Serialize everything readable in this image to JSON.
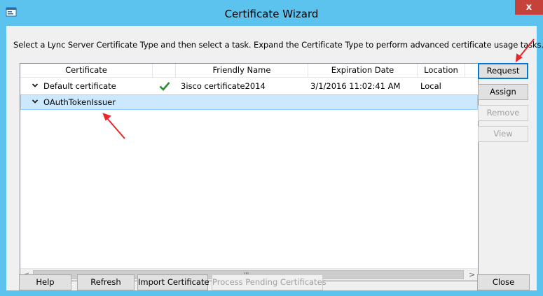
{
  "window": {
    "title": "Certificate Wizard",
    "close_glyph": "x",
    "app_icon": "window-app-icon",
    "accent_color": "#5bc3ee"
  },
  "instructions": "Select a Lync Server Certificate Type and then select a task. Expand the Certificate Type to perform advanced certificate usage tasks.",
  "table": {
    "columns": [
      "Certificate",
      "",
      "Friendly Name",
      "Expiration Date",
      "Location"
    ],
    "rows": [
      {
        "certificate": "Default certificate",
        "status_icon": "check-icon",
        "friendly_name": "3isco certificate2014",
        "expiration_date": "3/1/2016 11:02:41 AM",
        "location": "Local",
        "selected": false
      },
      {
        "certificate": "OAuthTokenIssuer",
        "status_icon": "",
        "friendly_name": "",
        "expiration_date": "",
        "location": "",
        "selected": true
      }
    ],
    "scroll_grip": "III",
    "scroll_left": "<",
    "scroll_right": ">"
  },
  "side_buttons": {
    "request": "Request",
    "assign": "Assign",
    "remove": "Remove",
    "view": "View"
  },
  "bottom_buttons": {
    "help": "Help",
    "refresh": "Refresh",
    "import": "Import Certificate",
    "process": "Process Pending Certificates",
    "close": "Close"
  },
  "annotations": {
    "arrow_color": "#e8262d"
  }
}
